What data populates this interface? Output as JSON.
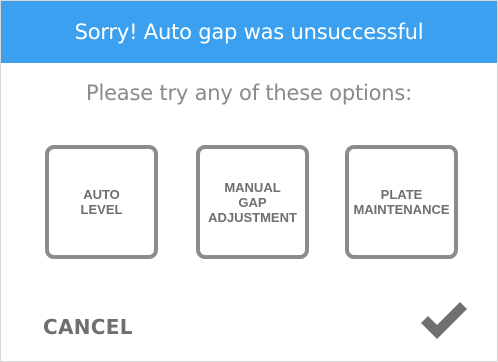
{
  "dialog": {
    "title": "Sorry! Auto gap was unsuccessful",
    "prompt": "Please try any of these options:",
    "options": [
      {
        "lines": [
          "AUTO",
          "LEVEL"
        ]
      },
      {
        "lines": [
          "MANUAL",
          "GAP",
          "ADJUSTMENT"
        ]
      },
      {
        "lines": [
          "PLATE",
          "MAINTENANCE"
        ]
      }
    ],
    "cancel_label": "CANCEL",
    "confirm_icon": "checkmark-icon"
  },
  "colors": {
    "header_bg": "#3aa0ef",
    "header_text": "#ffffff",
    "prompt_text": "#8a8a8a",
    "option_border": "#8c8c8c",
    "option_text": "#6f6f6f",
    "check": "#707070"
  }
}
